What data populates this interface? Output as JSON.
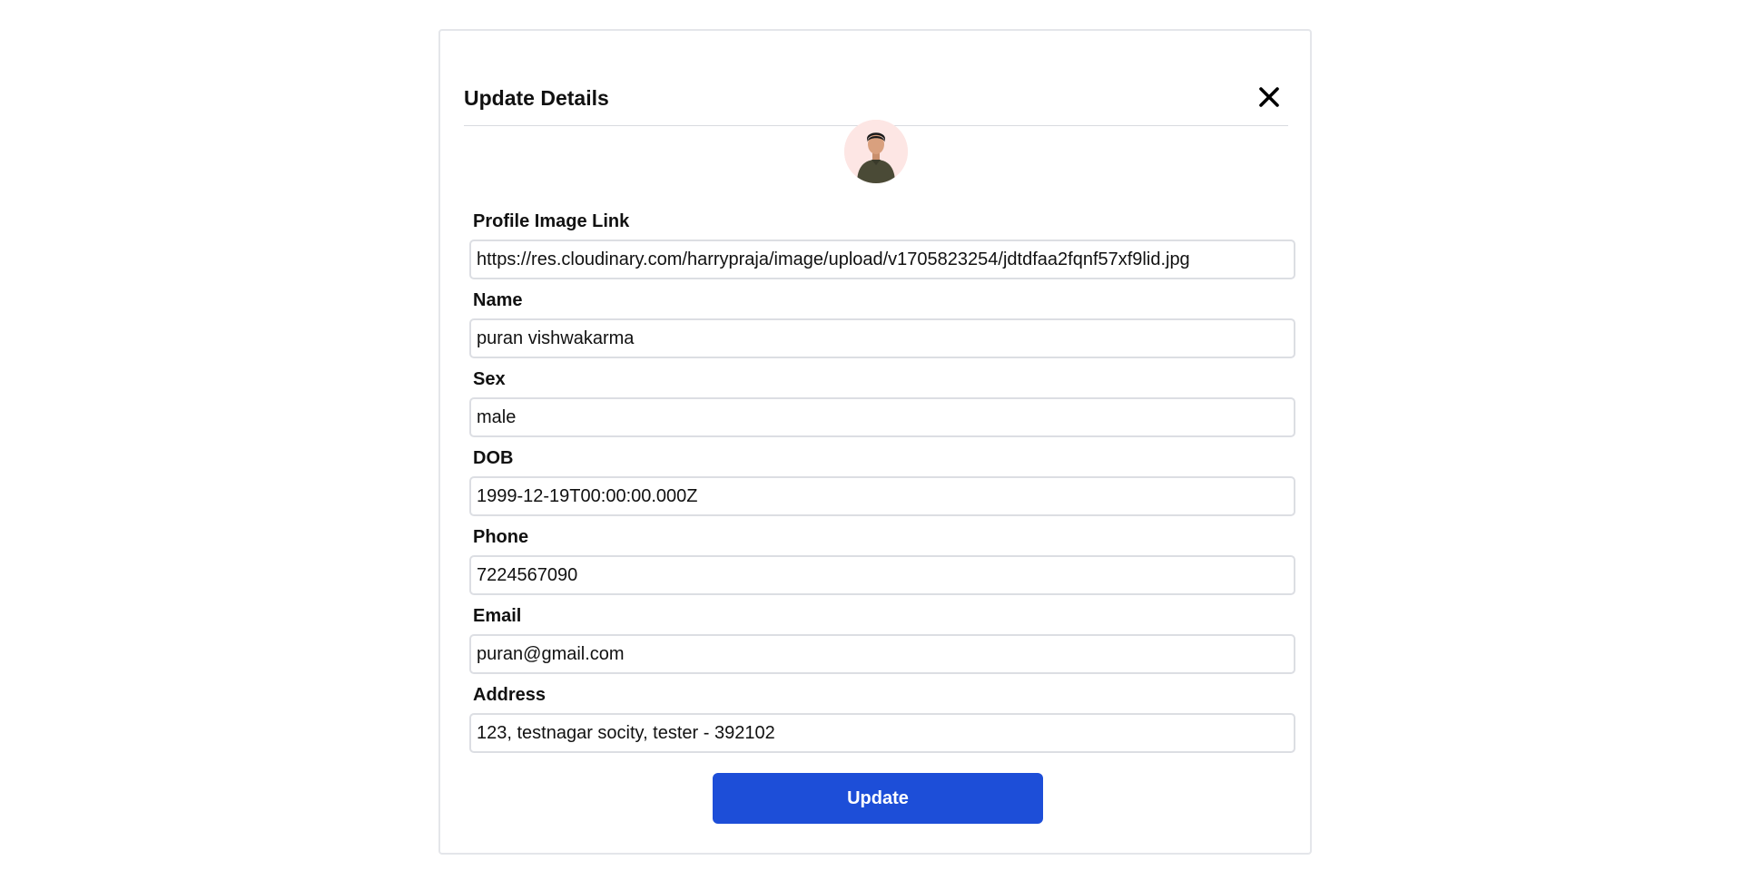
{
  "modal": {
    "title": "Update Details",
    "close_icon": "close-icon",
    "avatar_icon": "person-avatar-icon",
    "update_label": "Update",
    "accent_color": "#1d4ed8"
  },
  "fields": {
    "profile_image_link": {
      "label": "Profile Image Link",
      "value": "https://res.cloudinary.com/harrypraja/image/upload/v1705823254/jdtdfaa2fqnf57xf9lid.jpg"
    },
    "name": {
      "label": "Name",
      "value": "puran vishwakarma"
    },
    "sex": {
      "label": "Sex",
      "value": "male"
    },
    "dob": {
      "label": "DOB",
      "value": "1999-12-19T00:00:00.000Z"
    },
    "phone": {
      "label": "Phone",
      "value": "7224567090"
    },
    "email": {
      "label": "Email",
      "value": "puran@gmail.com"
    },
    "address": {
      "label": "Address",
      "value": "123, testnagar socity, tester - 392102"
    }
  }
}
